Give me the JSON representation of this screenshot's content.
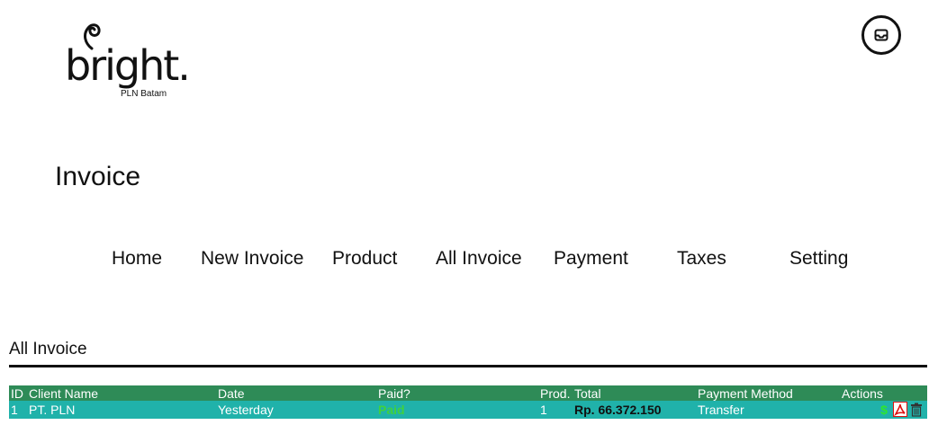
{
  "brand": {
    "wordmark": "bright.",
    "subtitle": "PLN Batam"
  },
  "header": {
    "inbox_icon": "inbox-icon"
  },
  "page": {
    "title": "Invoice"
  },
  "nav": {
    "items": [
      "Home",
      "New Invoice",
      "Product",
      "All Invoice",
      "Payment",
      "Taxes",
      "Setting"
    ]
  },
  "section": {
    "title": "All Invoice"
  },
  "table": {
    "columns": [
      "ID",
      "Client Name",
      "Date",
      "Paid?",
      "Prod.",
      "Total",
      "Payment Method",
      "Actions"
    ],
    "rows": [
      {
        "id": "1",
        "client": "PT. PLN",
        "date": "Yesterday",
        "paid": "Paid",
        "prod": "1",
        "total": "Rp. 66.372.150",
        "method": "Transfer",
        "actions": [
          "dollar-icon",
          "pdf-icon",
          "trash-icon"
        ]
      }
    ]
  },
  "colors": {
    "header_row": "#2e8b57",
    "data_row": "#20b2aa",
    "paid": "#3fd13f"
  }
}
